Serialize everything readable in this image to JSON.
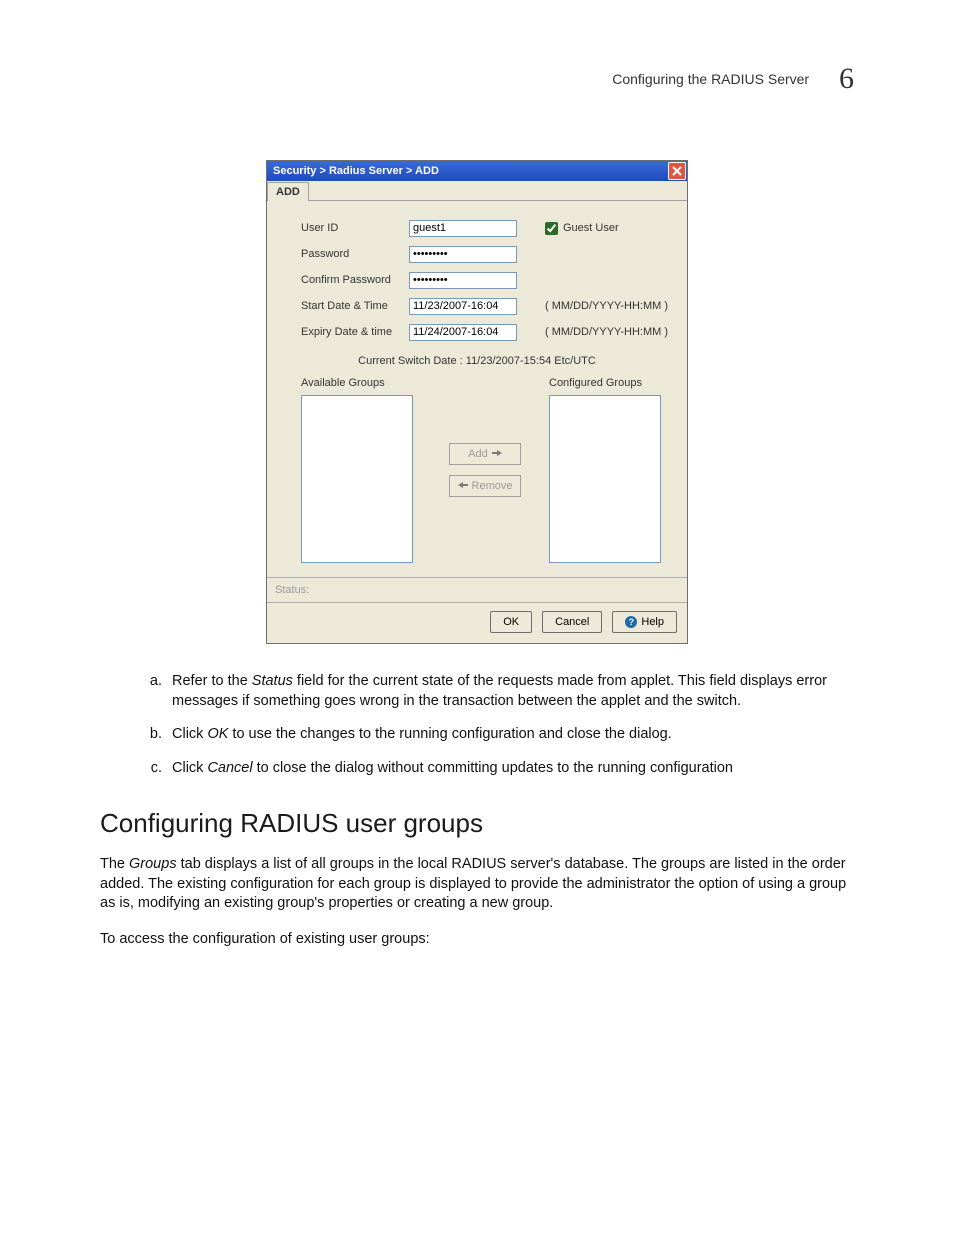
{
  "header": {
    "running_title": "Configuring the RADIUS Server",
    "chapter_number": "6"
  },
  "dialog": {
    "title": "Security > Radius Server > ADD",
    "tab_label": "ADD",
    "fields": {
      "user_id": {
        "label": "User ID",
        "value": "guest1"
      },
      "password": {
        "label": "Password",
        "value": "•••••••••"
      },
      "confirm_password": {
        "label": "Confirm Password",
        "value": "•••••••••"
      },
      "start_datetime": {
        "label": "Start Date & Time",
        "value": "11/23/2007-16:04",
        "hint": "( MM/DD/YYYY-HH:MM )"
      },
      "expiry_datetime": {
        "label": "Expiry Date & time",
        "value": "11/24/2007-16:04",
        "hint": "( MM/DD/YYYY-HH:MM )"
      },
      "guest_user": {
        "label": "Guest User",
        "checked": true
      }
    },
    "current_switch_date": "Current Switch Date :  11/23/2007-15:54  Etc/UTC",
    "groups": {
      "available_label": "Available Groups",
      "configured_label": "Configured Groups",
      "add_btn": "Add",
      "remove_btn": "Remove"
    },
    "status_label": "Status:",
    "buttons": {
      "ok": "OK",
      "cancel": "Cancel",
      "help": "Help"
    }
  },
  "body": {
    "list": {
      "a_pre": "Refer to the ",
      "a_em": "Status",
      "a_post": " field for the current state of the requests made from applet. This field displays error messages if something goes wrong in the transaction between the applet and the switch.",
      "b_pre": "Click ",
      "b_em": "OK",
      "b_post": " to use the changes to the running configuration and close the dialog.",
      "c_pre": "Click ",
      "c_em": "Cancel",
      "c_post": " to close the dialog without committing updates to the running configuration"
    },
    "section_heading": "Configuring RADIUS user groups",
    "para1_pre": "The ",
    "para1_em": "Groups",
    "para1_post": " tab displays a list of all groups in the local RADIUS server's database. The groups are listed in the order added. The existing configuration for each group is displayed to provide the administrator the option of using a group as is, modifying an existing group's properties or creating a new group.",
    "para2": "To access the configuration of existing user groups:"
  }
}
